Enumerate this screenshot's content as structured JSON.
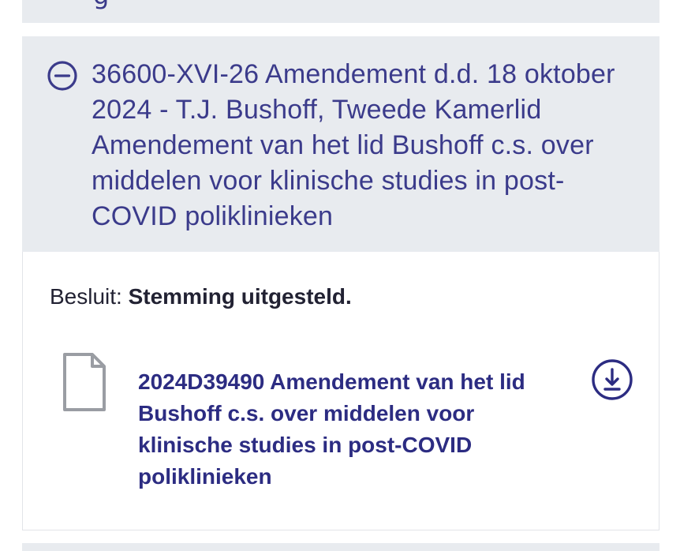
{
  "previous_item": {
    "peek_text": "g"
  },
  "item": {
    "title": "36600-XVI-26 Amendement d.d. 18 oktober 2024 - T.J. Bushoff, Tweede Kamerlid Amendement van het lid Bushoff c.s. over middelen voor klinische studies in post-COVID poliklinieken",
    "collapse_icon": "minus-circle-icon",
    "besluit_label": "Besluit:",
    "besluit_value": "Stemming uitgesteld.",
    "document": {
      "icon": "document-icon",
      "link_text": "2024D39490 Amendement van het lid Bushoff c.s. over middelen voor klinische studies in post-COVID poliklinieken",
      "download_icon": "download-circle-icon"
    }
  },
  "colors": {
    "header_bg": "#e8ebef",
    "title_text": "#3b3b8b",
    "link_text": "#2c2c82",
    "body_text": "#222233",
    "icon_grey": "#9a9da3"
  }
}
